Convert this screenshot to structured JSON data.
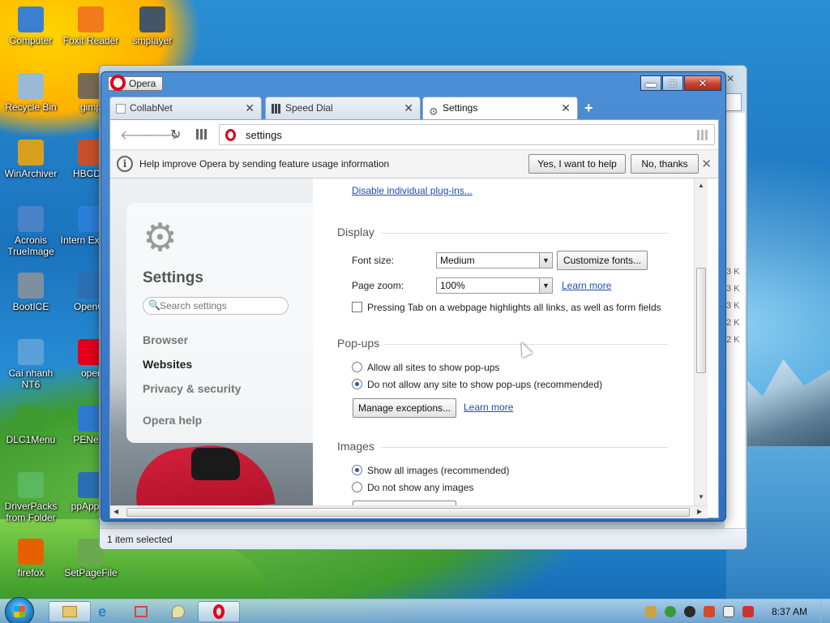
{
  "desktop": {
    "icons": [
      {
        "label": "Computer",
        "icon": "computer-icon",
        "color": "#3b7fd0"
      },
      {
        "label": "Foxit Reader",
        "icon": "pdf-icon",
        "color": "#f07a1c"
      },
      {
        "label": "smplayer",
        "icon": "penguin-icon",
        "color": "#445566"
      },
      {
        "label": "Recycle Bin",
        "icon": "recycle-bin-icon",
        "color": "#9ab9d4"
      },
      {
        "label": "gimp",
        "icon": "gimp-icon",
        "color": "#7a6a55"
      },
      {
        "label": "WinArchiver",
        "icon": "archive-icon",
        "color": "#d9a020"
      },
      {
        "label": "HBCDM",
        "icon": "tools-icon",
        "color": "#c8502a"
      },
      {
        "label": "Acronis TrueImage",
        "icon": "acronis-icon",
        "color": "#4a82c8"
      },
      {
        "label": "Intern Explore",
        "icon": "ie-icon",
        "color": "#2a7fd8"
      },
      {
        "label": "BootICE",
        "icon": "bootice-icon",
        "color": "#7d8fa0"
      },
      {
        "label": "OpenOf",
        "icon": "openoffice-icon",
        "color": "#2c6fb5"
      },
      {
        "label": "Cai nhanh NT6",
        "icon": "installer-icon",
        "color": "#5aa0d8"
      },
      {
        "label": "oper",
        "icon": "opera-icon",
        "color": "#e3001b"
      },
      {
        "label": "DLC1Menu",
        "icon": "dlc-icon",
        "color": "#3f9a2f"
      },
      {
        "label": "PENetw",
        "icon": "network-icon",
        "color": "#2f7ad0"
      },
      {
        "label": "DriverPacks from Folder",
        "icon": "driverpacks-icon",
        "color": "#5cb85c"
      },
      {
        "label": "ppAppsV",
        "icon": "apps-icon",
        "color": "#2a6fb5"
      },
      {
        "label": "firefox",
        "icon": "firefox-icon",
        "color": "#e66000"
      },
      {
        "label": "SetPageFile",
        "icon": "pagefile-icon",
        "color": "#6aa84f"
      }
    ]
  },
  "explorer": {
    "status": "1 item selected",
    "sizes": [
      "3 K",
      "3 K",
      "3 K",
      "2 K",
      "2 K"
    ]
  },
  "opera": {
    "menu_label": "Opera",
    "controls": {
      "minimize": "▬",
      "maximize": "□",
      "close": "✕"
    },
    "tabs": [
      {
        "label": "CollabNet",
        "icon": "page-icon"
      },
      {
        "label": "Speed Dial",
        "icon": "speed-dial-icon"
      },
      {
        "label": "Settings",
        "icon": "gear-icon",
        "active": true
      }
    ],
    "new_tab": "+",
    "address": {
      "url": "settings"
    },
    "infobar": {
      "message": "Help improve Opera by sending feature usage information",
      "accept": "Yes, I want to help",
      "decline": "No, thanks"
    },
    "settings": {
      "title": "Settings",
      "search_placeholder": "Search settings",
      "nav": [
        {
          "label": "Browser",
          "active": false
        },
        {
          "label": "Websites",
          "active": true
        },
        {
          "label": "Privacy & security",
          "active": false
        },
        {
          "label": "Opera help",
          "active": false
        }
      ],
      "plugins_link": "Disable individual plug-ins...",
      "display": {
        "title": "Display",
        "font_size_label": "Font size:",
        "font_size_value": "Medium",
        "customize_fonts": "Customize fonts...",
        "page_zoom_label": "Page zoom:",
        "page_zoom_value": "100%",
        "learn_more": "Learn more",
        "tab_highlight": "Pressing Tab on a webpage highlights all links, as well as form fields",
        "tab_highlight_checked": false
      },
      "popups": {
        "title": "Pop-ups",
        "allow": "Allow all sites to show pop-ups",
        "block": "Do not allow any site to show pop-ups (recommended)",
        "selected": "block",
        "manage": "Manage exceptions...",
        "learn_more": "Learn more"
      },
      "images": {
        "title": "Images",
        "show": "Show all images (recommended)",
        "hide": "Do not show any images",
        "selected": "show"
      }
    }
  },
  "taskbar": {
    "clock": "8:37 AM",
    "buttons": [
      "explorer-icon",
      "ie-icon",
      "network-icon",
      "paint-icon",
      "opera-icon"
    ]
  }
}
